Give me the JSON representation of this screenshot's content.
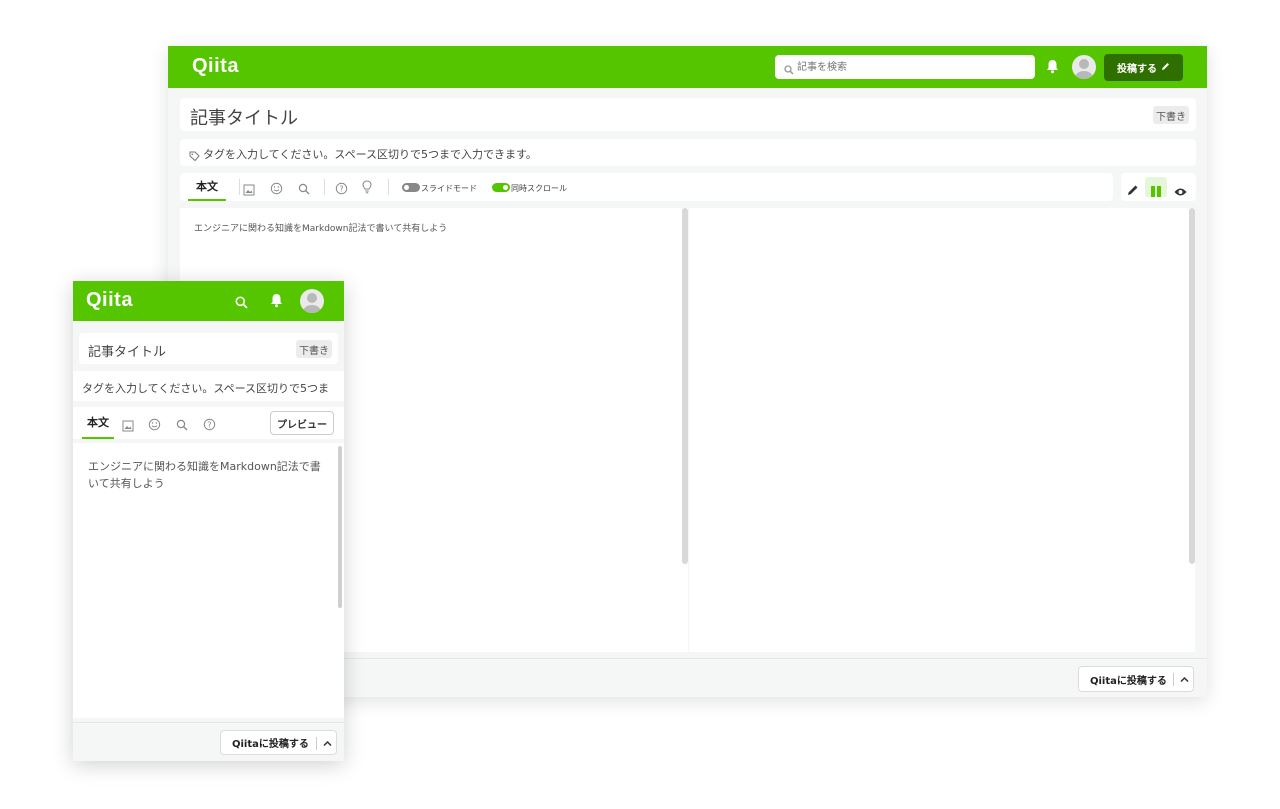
{
  "colors": {
    "brand": "#55c500",
    "post_button": "#2e6f00",
    "background": "#f5f6f6"
  },
  "desktop": {
    "header": {
      "logo": "Qiita",
      "search_placeholder": "記事を検索",
      "post_label": "投稿する",
      "icons": [
        "search-icon",
        "bell-icon",
        "avatar",
        "pencil-icon"
      ]
    },
    "title_placeholder": "記事タイトル",
    "draft_badge": "下書き",
    "tags_placeholder": "タグを入力してください。スペース区切りで5つまで入力できます。",
    "toolbar": {
      "body_tab": "本文",
      "icons": [
        "image-icon",
        "emoji-icon",
        "search-icon",
        "help-icon",
        "lightbulb-icon"
      ],
      "slide_mode_label": "スライドモード",
      "slide_mode_on": false,
      "sync_scroll_label": "同時スクロール",
      "sync_scroll_on": true
    },
    "view_modes": [
      "pencil-icon",
      "split-view-icon",
      "eye-icon"
    ],
    "active_view": "split-view-icon",
    "editor_placeholder": "エンジニアに関わる知識をMarkdown記法で書いて共有しよう",
    "footer": {
      "publish_label": "Qiitaに投稿する"
    }
  },
  "mobile": {
    "header": {
      "logo": "Qiita",
      "icons": [
        "search-icon",
        "bell-icon",
        "avatar"
      ]
    },
    "title_placeholder": "記事タイトル",
    "draft_badge": "下書き",
    "tags_placeholder": "タグを入力してください。スペース区切りで5つま",
    "toolbar": {
      "body_tab": "本文",
      "icons": [
        "image-icon",
        "emoji-icon",
        "search-icon",
        "help-icon"
      ],
      "preview_label": "プレビュー"
    },
    "editor_line1": "エンジニアに関わる知識をMarkdown記法で書",
    "editor_line2": "いて共有しよう",
    "footer": {
      "publish_label": "Qiitaに投稿する"
    }
  }
}
